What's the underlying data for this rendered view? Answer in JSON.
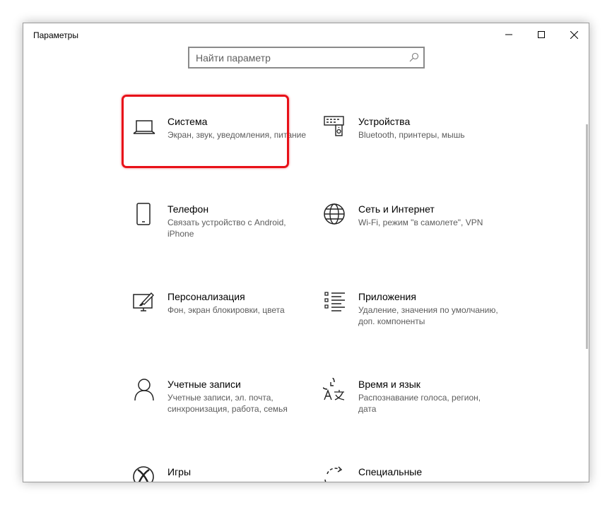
{
  "window": {
    "title": "Параметры"
  },
  "search": {
    "placeholder": "Найти параметр"
  },
  "tiles": [
    {
      "title": "Система",
      "desc": "Экран, звук, уведомления, питание",
      "icon": "laptop-icon"
    },
    {
      "title": "Устройства",
      "desc": "Bluetooth, принтеры, мышь",
      "icon": "devices-icon"
    },
    {
      "title": "Телефон",
      "desc": "Связать устройство с Android, iPhone",
      "icon": "phone-icon"
    },
    {
      "title": "Сеть и Интернет",
      "desc": "Wi-Fi, режим \"в самолете\", VPN",
      "icon": "globe-icon"
    },
    {
      "title": "Персонализация",
      "desc": "Фон, экран блокировки, цвета",
      "icon": "personalization-icon"
    },
    {
      "title": "Приложения",
      "desc": "Удаление, значения по умолчанию, доп. компоненты",
      "icon": "apps-list-icon"
    },
    {
      "title": "Учетные записи",
      "desc": "Учетные записи, эл. почта, синхронизация, работа, семья",
      "icon": "person-icon"
    },
    {
      "title": "Время и язык",
      "desc": "Распознавание голоса, регион, дата",
      "icon": "time-language-icon"
    },
    {
      "title": "Игры",
      "desc": "",
      "icon": "xbox-icon"
    },
    {
      "title": "Специальные",
      "desc": "",
      "icon": "ease-of-access-icon"
    }
  ],
  "highlight_color": "#e81018"
}
